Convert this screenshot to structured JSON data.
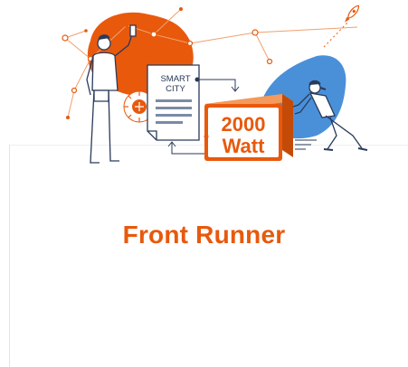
{
  "illustration": {
    "document_label_line1": "SMART",
    "document_label_line2": "CITY",
    "badge_line1": "2000",
    "badge_line2": "Watt"
  },
  "title": "Front Runner",
  "colors": {
    "accent": "#e8590c",
    "blue": "#4a90d9",
    "ink": "#2a3a5a"
  }
}
